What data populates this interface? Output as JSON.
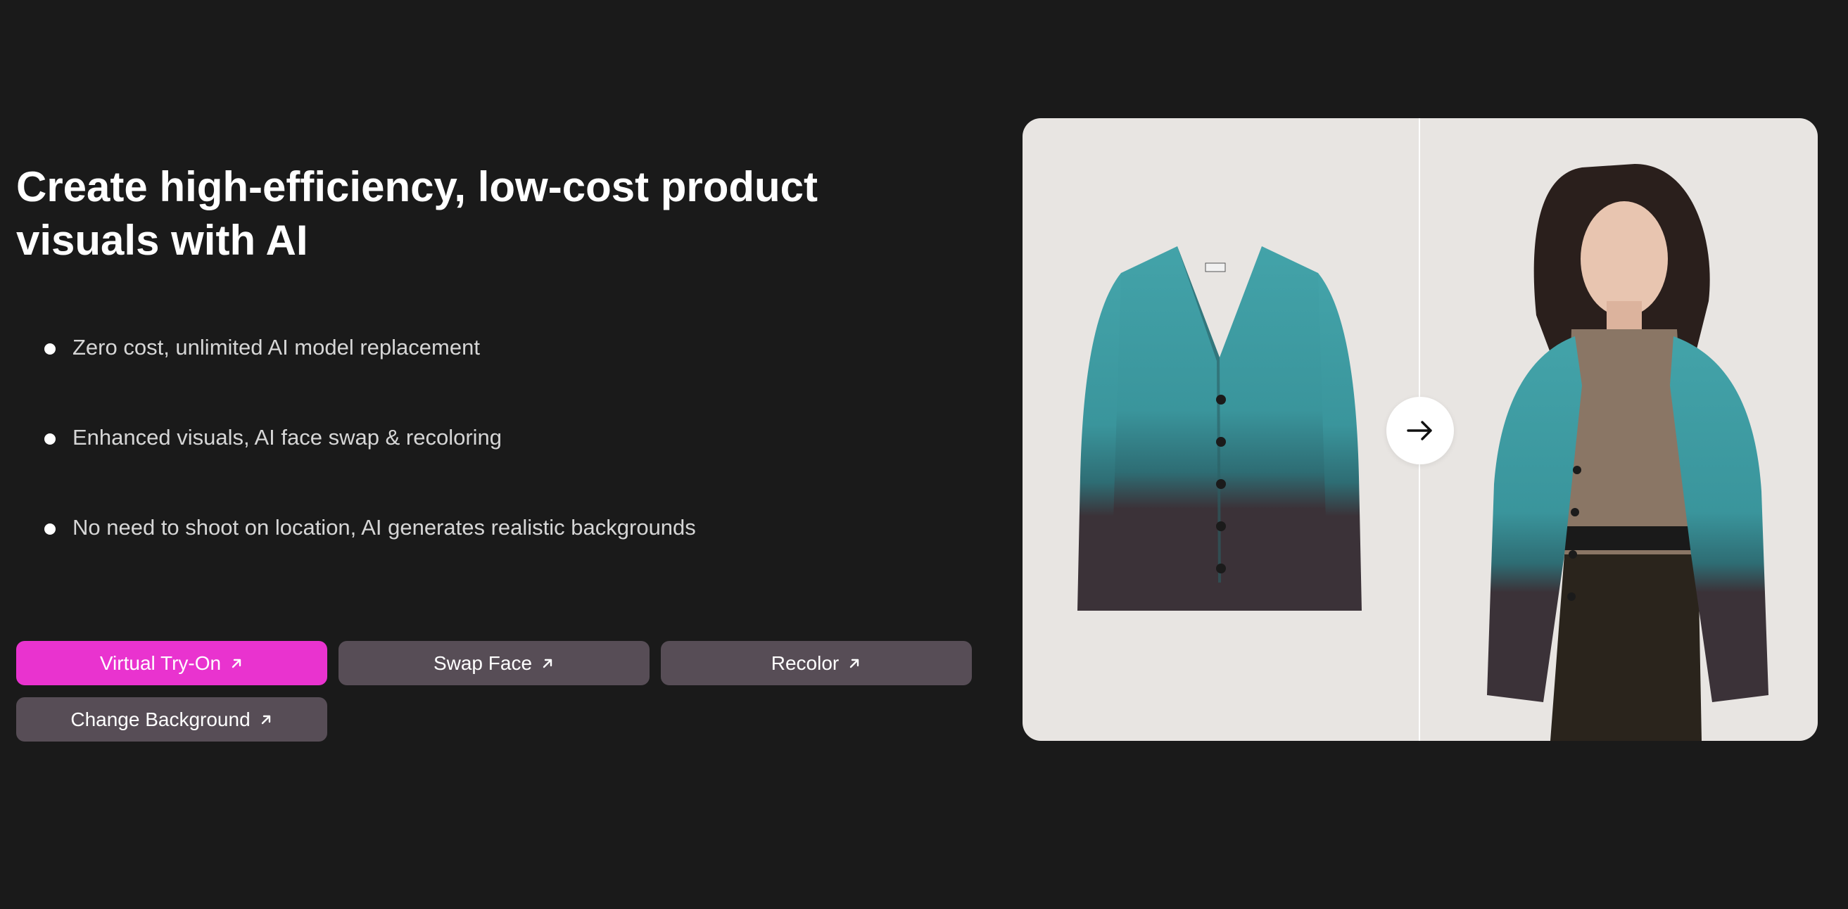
{
  "hero": {
    "title": "Create high-efficiency, low-cost product visuals with AI",
    "features": [
      "Zero cost, unlimited AI model replacement",
      "Enhanced visuals, AI face swap & recoloring",
      "No need to shoot on location, AI generates realistic backgrounds"
    ]
  },
  "actions": {
    "virtual_try_on": "Virtual Try-On",
    "swap_face": "Swap Face",
    "recolor": "Recolor",
    "change_background": "Change Background"
  },
  "icons": {
    "button_arrow": "arrow-up-right-icon",
    "compare_arrow": "arrow-right-icon"
  },
  "colors": {
    "background": "#1a1a1a",
    "primary_button": "#e933cf",
    "secondary_button": "#574d56",
    "panel_background": "#e8e5e2",
    "cardigan_teal": "#3a959c",
    "cardigan_dark": "#3b3238"
  }
}
